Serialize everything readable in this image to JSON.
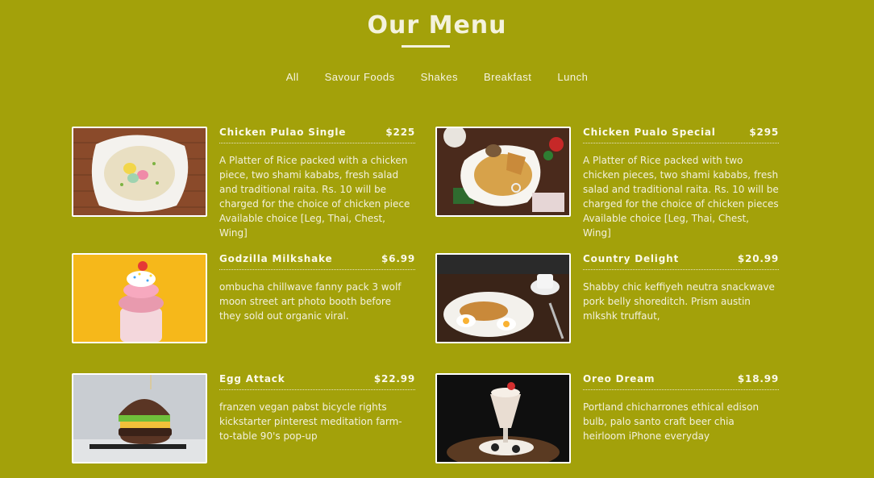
{
  "header": {
    "title": "Our Menu"
  },
  "filters": [
    "All",
    "Savour Foods",
    "Shakes",
    "Breakfast",
    "Lunch"
  ],
  "items": [
    {
      "name": "Chicken Pulao Single",
      "price": "$225",
      "description": "A Platter of Rice packed with a chicken piece, two shami kababs, fresh salad and traditional raita. Rs. 10 will be charged for the choice of chicken piece Available choice [Leg, Thai, Chest, Wing]",
      "image": "pulao-plate-image"
    },
    {
      "name": "Chicken Pualo Special",
      "price": "$295",
      "description": "A Platter of Rice packed with two chicken pieces, two shami kababs, fresh salad and traditional raita. Rs. 10 will be charged for the choice of chicken pieces Available choice [Leg, Thai, Chest, Wing]",
      "image": "pulao-special-image"
    },
    {
      "name": "Godzilla Milkshake",
      "price": "$6.99",
      "description": "ombucha chillwave fanny pack 3 wolf moon street art photo booth before they sold out organic viral.",
      "image": "milkshake-image"
    },
    {
      "name": "Country Delight",
      "price": "$20.99",
      "description": "Shabby chic keffiyeh neutra snackwave pork belly shoreditch. Prism austin mlkshk truffaut,",
      "image": "breakfast-image"
    },
    {
      "name": "Egg Attack",
      "price": "$22.99",
      "description": "franzen vegan pabst bicycle rights kickstarter pinterest meditation farm-to-table 90's pop-up",
      "image": "burger-image"
    },
    {
      "name": "Oreo Dream",
      "price": "$18.99",
      "description": "Portland chicharrones ethical edison bulb, palo santo craft beer chia heirloom iPhone everyday",
      "image": "oreo-shake-image"
    }
  ],
  "colors": {
    "background": "#a3a10a",
    "text": "#fdfbe8"
  }
}
